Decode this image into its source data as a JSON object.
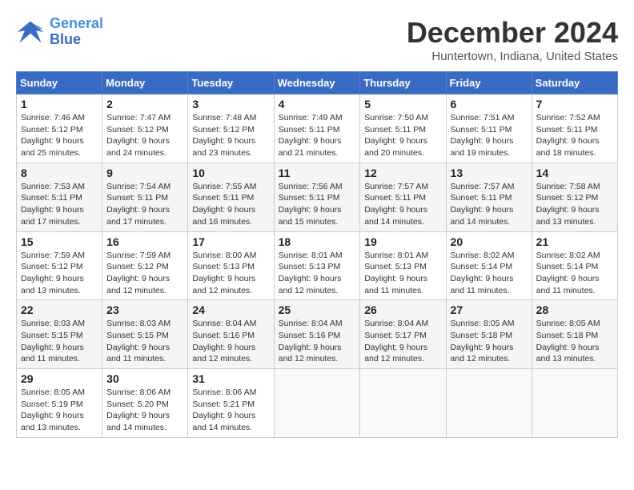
{
  "logo": {
    "line1": "General",
    "line2": "Blue"
  },
  "title": "December 2024",
  "location": "Huntertown, Indiana, United States",
  "weekdays": [
    "Sunday",
    "Monday",
    "Tuesday",
    "Wednesday",
    "Thursday",
    "Friday",
    "Saturday"
  ],
  "weeks": [
    [
      {
        "day": "1",
        "sunrise": "Sunrise: 7:46 AM",
        "sunset": "Sunset: 5:12 PM",
        "daylight": "Daylight: 9 hours and 25 minutes."
      },
      {
        "day": "2",
        "sunrise": "Sunrise: 7:47 AM",
        "sunset": "Sunset: 5:12 PM",
        "daylight": "Daylight: 9 hours and 24 minutes."
      },
      {
        "day": "3",
        "sunrise": "Sunrise: 7:48 AM",
        "sunset": "Sunset: 5:12 PM",
        "daylight": "Daylight: 9 hours and 23 minutes."
      },
      {
        "day": "4",
        "sunrise": "Sunrise: 7:49 AM",
        "sunset": "Sunset: 5:11 PM",
        "daylight": "Daylight: 9 hours and 21 minutes."
      },
      {
        "day": "5",
        "sunrise": "Sunrise: 7:50 AM",
        "sunset": "Sunset: 5:11 PM",
        "daylight": "Daylight: 9 hours and 20 minutes."
      },
      {
        "day": "6",
        "sunrise": "Sunrise: 7:51 AM",
        "sunset": "Sunset: 5:11 PM",
        "daylight": "Daylight: 9 hours and 19 minutes."
      },
      {
        "day": "7",
        "sunrise": "Sunrise: 7:52 AM",
        "sunset": "Sunset: 5:11 PM",
        "daylight": "Daylight: 9 hours and 18 minutes."
      }
    ],
    [
      {
        "day": "8",
        "sunrise": "Sunrise: 7:53 AM",
        "sunset": "Sunset: 5:11 PM",
        "daylight": "Daylight: 9 hours and 17 minutes."
      },
      {
        "day": "9",
        "sunrise": "Sunrise: 7:54 AM",
        "sunset": "Sunset: 5:11 PM",
        "daylight": "Daylight: 9 hours and 17 minutes."
      },
      {
        "day": "10",
        "sunrise": "Sunrise: 7:55 AM",
        "sunset": "Sunset: 5:11 PM",
        "daylight": "Daylight: 9 hours and 16 minutes."
      },
      {
        "day": "11",
        "sunrise": "Sunrise: 7:56 AM",
        "sunset": "Sunset: 5:11 PM",
        "daylight": "Daylight: 9 hours and 15 minutes."
      },
      {
        "day": "12",
        "sunrise": "Sunrise: 7:57 AM",
        "sunset": "Sunset: 5:11 PM",
        "daylight": "Daylight: 9 hours and 14 minutes."
      },
      {
        "day": "13",
        "sunrise": "Sunrise: 7:57 AM",
        "sunset": "Sunset: 5:11 PM",
        "daylight": "Daylight: 9 hours and 14 minutes."
      },
      {
        "day": "14",
        "sunrise": "Sunrise: 7:58 AM",
        "sunset": "Sunset: 5:12 PM",
        "daylight": "Daylight: 9 hours and 13 minutes."
      }
    ],
    [
      {
        "day": "15",
        "sunrise": "Sunrise: 7:59 AM",
        "sunset": "Sunset: 5:12 PM",
        "daylight": "Daylight: 9 hours and 13 minutes."
      },
      {
        "day": "16",
        "sunrise": "Sunrise: 7:59 AM",
        "sunset": "Sunset: 5:12 PM",
        "daylight": "Daylight: 9 hours and 12 minutes."
      },
      {
        "day": "17",
        "sunrise": "Sunrise: 8:00 AM",
        "sunset": "Sunset: 5:13 PM",
        "daylight": "Daylight: 9 hours and 12 minutes."
      },
      {
        "day": "18",
        "sunrise": "Sunrise: 8:01 AM",
        "sunset": "Sunset: 5:13 PM",
        "daylight": "Daylight: 9 hours and 12 minutes."
      },
      {
        "day": "19",
        "sunrise": "Sunrise: 8:01 AM",
        "sunset": "Sunset: 5:13 PM",
        "daylight": "Daylight: 9 hours and 11 minutes."
      },
      {
        "day": "20",
        "sunrise": "Sunrise: 8:02 AM",
        "sunset": "Sunset: 5:14 PM",
        "daylight": "Daylight: 9 hours and 11 minutes."
      },
      {
        "day": "21",
        "sunrise": "Sunrise: 8:02 AM",
        "sunset": "Sunset: 5:14 PM",
        "daylight": "Daylight: 9 hours and 11 minutes."
      }
    ],
    [
      {
        "day": "22",
        "sunrise": "Sunrise: 8:03 AM",
        "sunset": "Sunset: 5:15 PM",
        "daylight": "Daylight: 9 hours and 11 minutes."
      },
      {
        "day": "23",
        "sunrise": "Sunrise: 8:03 AM",
        "sunset": "Sunset: 5:15 PM",
        "daylight": "Daylight: 9 hours and 11 minutes."
      },
      {
        "day": "24",
        "sunrise": "Sunrise: 8:04 AM",
        "sunset": "Sunset: 5:16 PM",
        "daylight": "Daylight: 9 hours and 12 minutes."
      },
      {
        "day": "25",
        "sunrise": "Sunrise: 8:04 AM",
        "sunset": "Sunset: 5:16 PM",
        "daylight": "Daylight: 9 hours and 12 minutes."
      },
      {
        "day": "26",
        "sunrise": "Sunrise: 8:04 AM",
        "sunset": "Sunset: 5:17 PM",
        "daylight": "Daylight: 9 hours and 12 minutes."
      },
      {
        "day": "27",
        "sunrise": "Sunrise: 8:05 AM",
        "sunset": "Sunset: 5:18 PM",
        "daylight": "Daylight: 9 hours and 12 minutes."
      },
      {
        "day": "28",
        "sunrise": "Sunrise: 8:05 AM",
        "sunset": "Sunset: 5:18 PM",
        "daylight": "Daylight: 9 hours and 13 minutes."
      }
    ],
    [
      {
        "day": "29",
        "sunrise": "Sunrise: 8:05 AM",
        "sunset": "Sunset: 5:19 PM",
        "daylight": "Daylight: 9 hours and 13 minutes."
      },
      {
        "day": "30",
        "sunrise": "Sunrise: 8:06 AM",
        "sunset": "Sunset: 5:20 PM",
        "daylight": "Daylight: 9 hours and 14 minutes."
      },
      {
        "day": "31",
        "sunrise": "Sunrise: 8:06 AM",
        "sunset": "Sunset: 5:21 PM",
        "daylight": "Daylight: 9 hours and 14 minutes."
      },
      null,
      null,
      null,
      null
    ]
  ]
}
